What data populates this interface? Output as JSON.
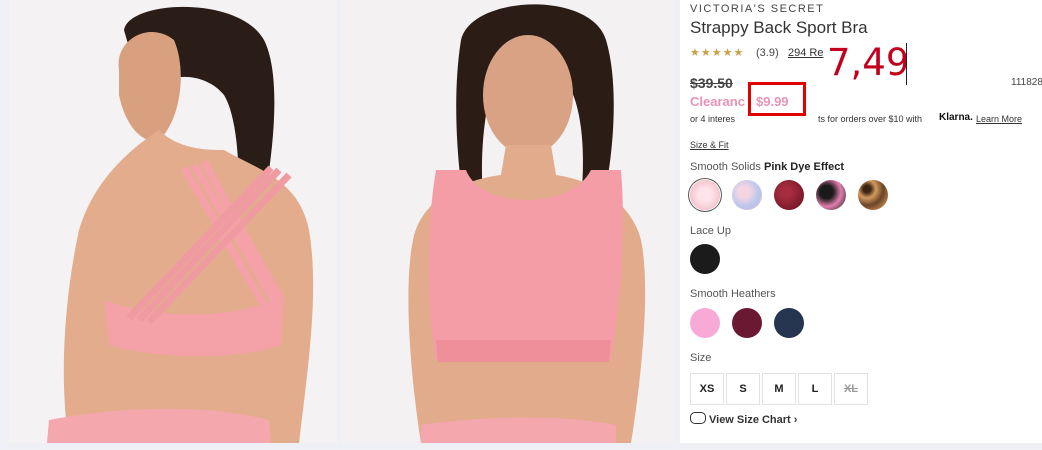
{
  "product": {
    "brand": "VICTORIA'S SECRET",
    "name": "Strappy Back Sport Bra",
    "stars": "★★★★★",
    "rating_value": 3.9,
    "rating_text": "(3.9)",
    "reviews_link": "294 Re",
    "item_number": "111828",
    "original_price": "$39.50",
    "clearance_label": "Clearanc",
    "sale_price": "$9.99",
    "overlay_price": "7,49",
    "klarna_text_pre": "or 4 interes",
    "klarna_text_post": "ts for orders over $10 with",
    "klarna_brand": "Klarna.",
    "learn_more": "Learn More",
    "size_fit_link": "Size & Fit"
  },
  "color_groups": [
    {
      "label_pre": "Smooth Solids",
      "label_selected": "Pink Dye Effect"
    },
    {
      "label_pre": "Lace Up"
    },
    {
      "label_pre": "Smooth Heathers"
    }
  ],
  "sizes": {
    "label": "Size",
    "options": [
      "XS",
      "S",
      "M",
      "L",
      "XL"
    ]
  },
  "size_chart_link": "View Size Chart ›",
  "colors": {
    "accent_pink": "#e893b7",
    "annotation_red": "#e00000",
    "overlay_text": "#c2001e",
    "swatches": [
      "#f6c2cc",
      "#c8d0ea",
      "#7a1d2a",
      "#d36fa0",
      "#b87c45",
      "#1b1b1b",
      "#f7a8d6",
      "#6b1933",
      "#253550"
    ]
  }
}
